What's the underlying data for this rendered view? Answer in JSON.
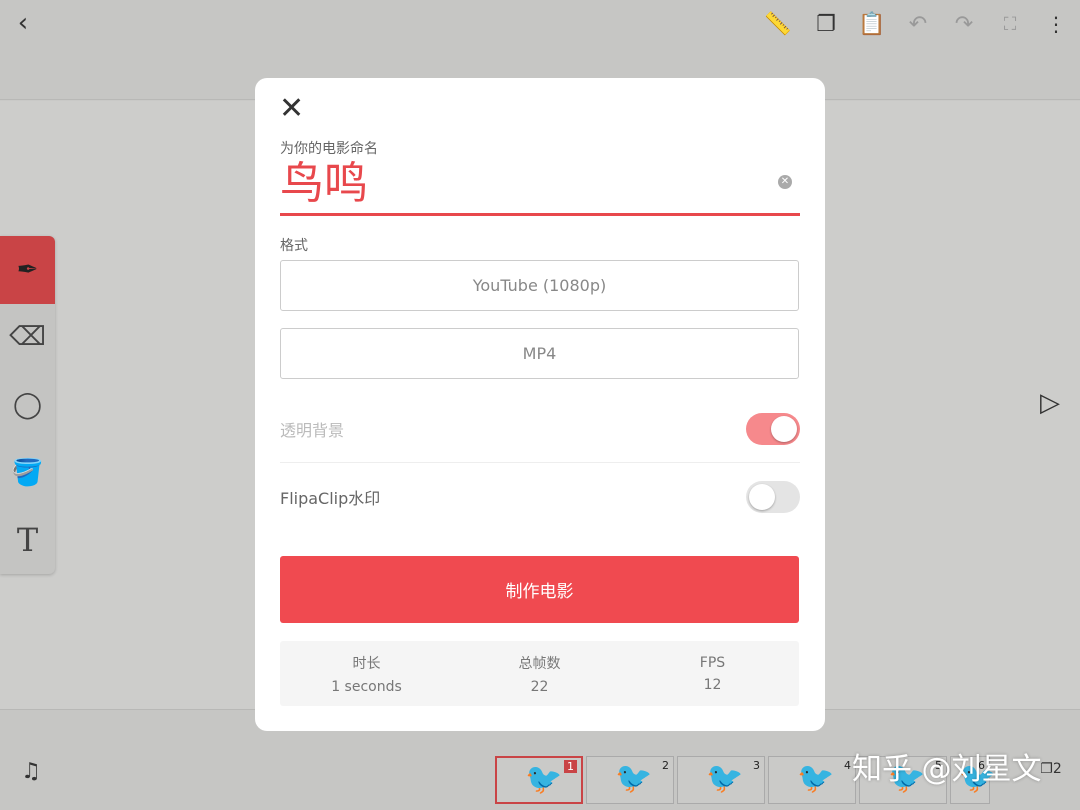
{
  "toolbar": {
    "icons": [
      "back-icon",
      "ruler-icon",
      "copy-icon",
      "paste-icon",
      "undo-icon",
      "redo-icon",
      "fullscreen-icon",
      "more-icon"
    ]
  },
  "tools": [
    "pen",
    "eraser",
    "lasso",
    "fill",
    "text"
  ],
  "dialog": {
    "name_label": "为你的电影命名",
    "name_value": "鸟鸣",
    "format_label": "格式",
    "resolution": "YouTube (1080p)",
    "file_type": "MP4",
    "transparent_bg_label": "透明背景",
    "transparent_bg_on": true,
    "watermark_label": "FlipaClip水印",
    "watermark_on": false,
    "make_button": "制作电影",
    "stats": [
      {
        "label": "时长",
        "value": "1 seconds"
      },
      {
        "label": "总帧数",
        "value": "22"
      },
      {
        "label": "FPS",
        "value": "12"
      }
    ]
  },
  "frames": [
    "1",
    "2",
    "3",
    "4",
    "5",
    "6"
  ],
  "layers_count": "2",
  "watermark": "知乎 @刘星文",
  "colors": {
    "accent": "#f04a50",
    "toggle_on": "#f6898c"
  }
}
